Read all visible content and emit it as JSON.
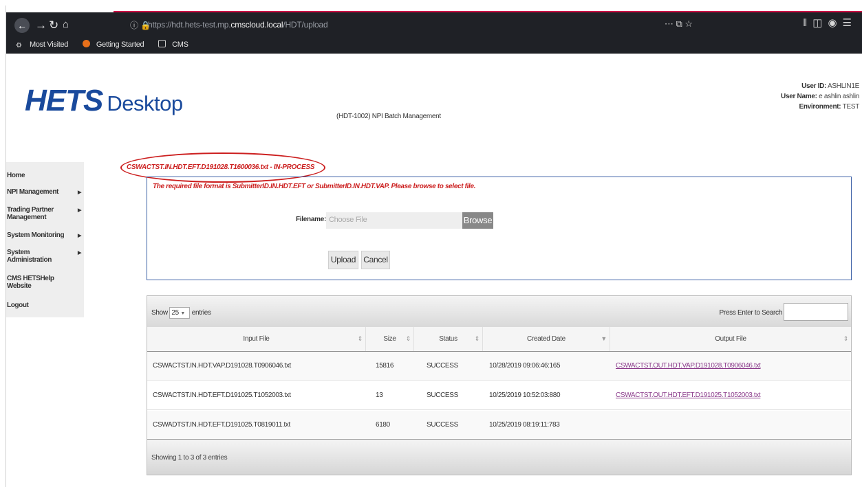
{
  "browser": {
    "url_prefix": "https://hdt.hets-test.mp.",
    "url_domain": "cmscloud.local",
    "url_path": "/HDT/upload",
    "url_actions": "⋯ ⧉ ☆",
    "bookmarks": [
      "Most Visited",
      "Getting Started",
      "CMS"
    ]
  },
  "header": {
    "logo_main": "HETS",
    "logo_sub": "Desktop",
    "page_title": "(HDT-1002) NPI Batch Management",
    "user_id_label": "User ID:",
    "user_id": "ASHLIN1E",
    "user_name_label": "User Name:",
    "user_name": "e ashlin ashlin",
    "environment_label": "Environment:",
    "environment": "TEST"
  },
  "sidebar": {
    "items": [
      {
        "label": "Home",
        "has_arrow": false
      },
      {
        "label": "NPI Management",
        "has_arrow": true
      },
      {
        "label": "Trading Partner Management",
        "has_arrow": true
      },
      {
        "label": "System Monitoring",
        "has_arrow": true
      },
      {
        "label": "System Administration",
        "has_arrow": true
      },
      {
        "label": "CMS HETSHelp Website",
        "has_arrow": false
      },
      {
        "label": "Logout",
        "has_arrow": false
      }
    ]
  },
  "upload": {
    "status_message": "CSWACTST.IN.HDT.EFT.D191028.T1600036.txt - IN-PROCESS",
    "hint": "The required file format is SubmitterID.IN.HDT.EFT or SubmitterID.IN.HDT.VAP. Please browse to select file.",
    "filename_label": "Filename:",
    "filename_placeholder": "Choose File",
    "browse_label": "Browse",
    "upload_label": "Upload",
    "cancel_label": "Cancel"
  },
  "table": {
    "show_label": "Show",
    "entries_value": "25",
    "entries_label": "entries",
    "search_label": "Press Enter to Search",
    "columns": [
      "Input File",
      "Size",
      "Status",
      "Created Date",
      "Output File"
    ],
    "rows": [
      {
        "input": "CSWACTST.IN.HDT.VAP.D191028.T0906046.txt",
        "size": "15816",
        "status": "SUCCESS",
        "created": "10/28/2019 09:06:46:165",
        "output": "CSWACTST.OUT.HDT.VAP.D191028.T0906046.txt"
      },
      {
        "input": "CSWACTST.IN.HDT.EFT.D191025.T1052003.txt",
        "size": "13",
        "status": "SUCCESS",
        "created": "10/25/2019 10:52:03:880",
        "output": "CSWACTST.OUT.HDT.EFT.D191025.T1052003.txt"
      },
      {
        "input": "CSWADTST.IN.HDT.EFT.D191025.T0819011.txt",
        "size": "6180",
        "status": "SUCCESS",
        "created": "10/25/2019 08:19:11:783",
        "output": ""
      }
    ],
    "showing": "Showing 1 to 3 of 3 entries"
  },
  "colors": {
    "logo": "#1a4a9c",
    "error": "#cc2020",
    "annotation": "#cc1f1f",
    "link": "#8a3a8a"
  }
}
